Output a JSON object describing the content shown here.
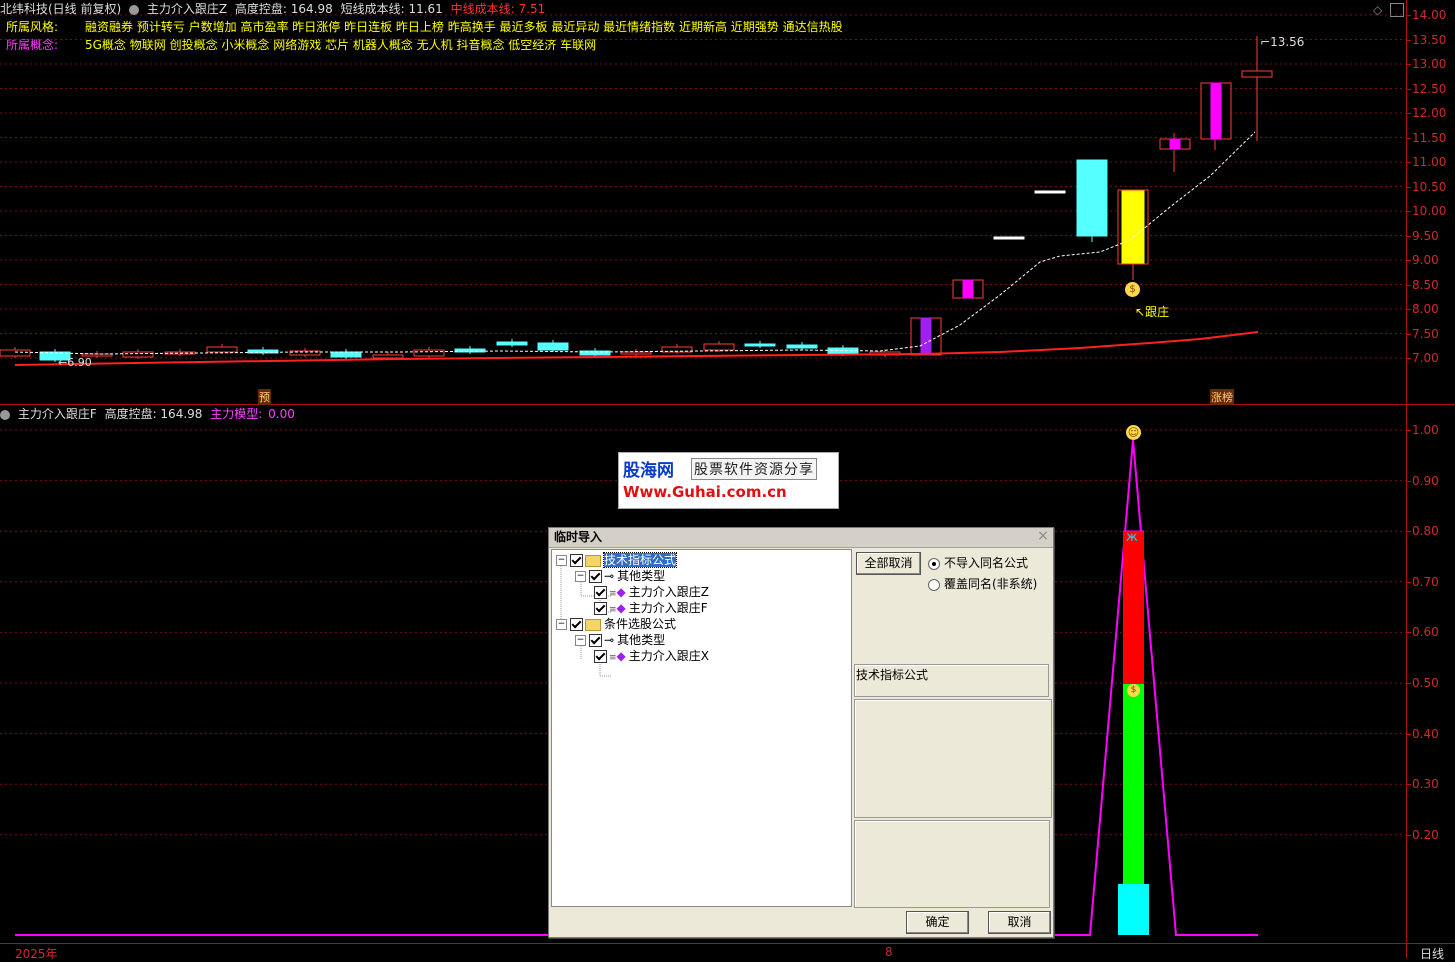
{
  "header": {
    "stock": "北纬科技(日线 前复权)",
    "indicator": "主力介入跟庄Z",
    "metric1": "高度控盘: 164.98",
    "metric2": "短线成本线: 11.61",
    "metric3": "中线成本线: 7.51"
  },
  "info": {
    "style_label": "所属风格:",
    "style_value": "融资融券 预计转亏 户数增加 高市盈率 昨日涨停 昨日连板 昨日上榜 昨高换手 最近多板 最近异动 最近情绪指数 近期新高 近期强势 通达信热股",
    "concept_label": "所属概念:",
    "concept_value": "5G概念 物联网 创投概念 小米概念 网络游戏 芯片 机器人概念 无人机 抖音概念 低空经济 车联网"
  },
  "upper_axis": [
    "14.00",
    "13.50",
    "13.00",
    "12.50",
    "12.00",
    "11.50",
    "11.00",
    "10.50",
    "10.00",
    "9.50",
    "9.00",
    "8.50",
    "8.00",
    "7.50",
    "7.00"
  ],
  "upper_labels": {
    "high": "13.56",
    "low": "6.90",
    "follow": "跟庄",
    "pre": "预",
    "limit_up": "涨榜"
  },
  "lower_header": {
    "indicator": "主力介入跟庄F",
    "metric1": "高度控盘: 164.98",
    "metric2_label": "主力模型:",
    "metric2_value": "0.00"
  },
  "lower_axis": [
    "1.00",
    "0.90",
    "0.80",
    "0.70",
    "0.60",
    "0.50",
    "0.40",
    "0.30",
    "0.20"
  ],
  "footer": {
    "year": "2025年",
    "month": "8",
    "period": "日线"
  },
  "watermark": {
    "line1": "股海网",
    "line2": "股票软件资源分享",
    "line3": "Www.Guhai.com.cn"
  },
  "dialog": {
    "title": "临时导入",
    "tree": [
      {
        "label": "技术指标公式",
        "level": 0,
        "folder": true,
        "selected": true
      },
      {
        "label": "其他类型",
        "level": 1
      },
      {
        "label": "主力介入跟庄Z",
        "level": 2
      },
      {
        "label": "主力介入跟庄F",
        "level": 2
      },
      {
        "label": "条件选股公式",
        "level": 0,
        "folder": true
      },
      {
        "label": "其他类型",
        "level": 1
      },
      {
        "label": "主力介入跟庄X",
        "level": 2
      }
    ],
    "deselect_all": "全部取消",
    "radio1": "不导入同名公式",
    "radio2": "覆盖同名(非系统)",
    "type_label": "技术指标公式",
    "ok": "确定",
    "cancel": "取消"
  },
  "colors": {
    "up": "#ff3a3a",
    "down": "#54ffff",
    "grid": "#7a1010",
    "magenta": "#ff00ff",
    "yellow": "#ffff00"
  }
}
